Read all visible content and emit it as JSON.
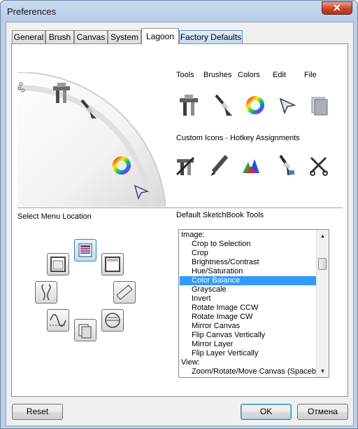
{
  "window": {
    "title": "Preferences",
    "close_glyph": "✕"
  },
  "tabs": [
    {
      "label": "General"
    },
    {
      "label": "Brush"
    },
    {
      "label": "Canvas"
    },
    {
      "label": "System"
    },
    {
      "label": "Lagoon",
      "active": true
    },
    {
      "label": "Factory Defaults"
    }
  ],
  "tools_header": [
    "Tools",
    "Brushes",
    "Colors",
    "Edit",
    "File"
  ],
  "tool_icons": [
    "tools-icon",
    "brush-icon",
    "color-wheel-icon",
    "cursor-arrow-icon",
    "file-pages-icon"
  ],
  "custom_icons_label": "Custom Icons - Hotkey Assignments",
  "custom_icons": [
    "custom-tools-icon",
    "pencil-icon",
    "color-puck-icon",
    "custom-brush-icon",
    "scissors-tools-icon"
  ],
  "select_menu_location_label": "Select Menu Location",
  "default_tools_label": "Default SketchBook Tools",
  "tools_list": [
    {
      "text": "Image:",
      "indent": false
    },
    {
      "text": "Crop to Selection",
      "indent": true
    },
    {
      "text": "Crop",
      "indent": true
    },
    {
      "text": "Brightness/Contrast",
      "indent": true
    },
    {
      "text": "Hue/Saturation",
      "indent": true
    },
    {
      "text": "Color Balance",
      "indent": true,
      "selected": true
    },
    {
      "text": "Grayscale",
      "indent": true
    },
    {
      "text": "Invert",
      "indent": true
    },
    {
      "text": "Rotate Image CCW",
      "indent": true
    },
    {
      "text": "Rotate Image CW",
      "indent": true
    },
    {
      "text": "Mirror Canvas",
      "indent": true
    },
    {
      "text": "Flip Canvas Vertically",
      "indent": true
    },
    {
      "text": "Mirror Layer",
      "indent": true
    },
    {
      "text": "Flip Layer Vertically",
      "indent": true
    },
    {
      "text": "View:",
      "indent": false
    },
    {
      "text": "Zoom/Rotate/Move Canvas (Spacebar)",
      "indent": true
    }
  ],
  "buttons": {
    "reset": "Reset",
    "ok": "OK",
    "cancel": "Отмена"
  },
  "colors": {
    "selection": "#3399ff",
    "close": "#c6452b",
    "frame": "#bcd0e6"
  }
}
